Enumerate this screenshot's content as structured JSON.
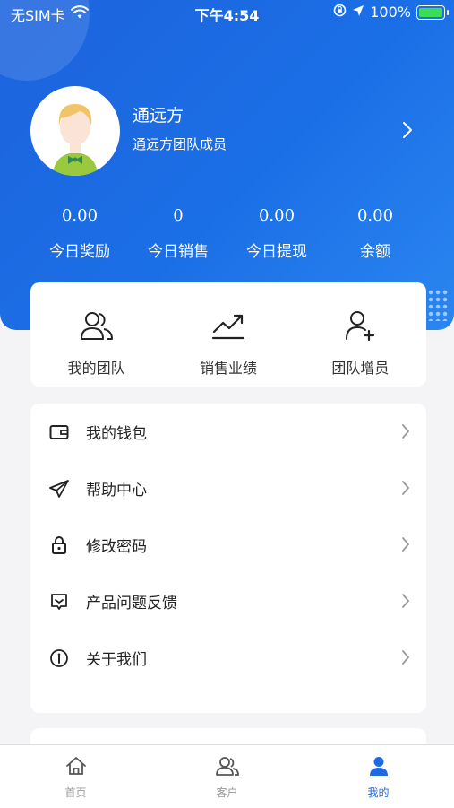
{
  "status_bar": {
    "carrier": "无SIM卡",
    "time": "下午4:54",
    "battery": "100%"
  },
  "profile": {
    "name": "通远方",
    "role": "通远方团队成员"
  },
  "stats": [
    {
      "value": "0.00",
      "label": "今日奖励"
    },
    {
      "value": "0",
      "label": "今日销售"
    },
    {
      "value": "0.00",
      "label": "今日提现"
    },
    {
      "value": "0.00",
      "label": "余额"
    }
  ],
  "quick_actions": [
    {
      "label": "我的团队",
      "icon": "team-icon"
    },
    {
      "label": "销售业绩",
      "icon": "trend-icon"
    },
    {
      "label": "团队增员",
      "icon": "add-member-icon"
    }
  ],
  "menu": [
    {
      "label": "我的钱包",
      "icon": "wallet-icon"
    },
    {
      "label": "帮助中心",
      "icon": "paper-plane-icon"
    },
    {
      "label": "修改密码",
      "icon": "lock-icon"
    },
    {
      "label": "产品问题反馈",
      "icon": "feedback-icon"
    },
    {
      "label": "关于我们",
      "icon": "info-icon"
    }
  ],
  "tabbar": [
    {
      "label": "首页",
      "icon": "home-icon"
    },
    {
      "label": "客户",
      "icon": "customers-icon"
    },
    {
      "label": "我的",
      "icon": "profile-icon",
      "active": true
    }
  ],
  "colors": {
    "primary": "#1f6ae0",
    "battery": "#3cdd55"
  }
}
